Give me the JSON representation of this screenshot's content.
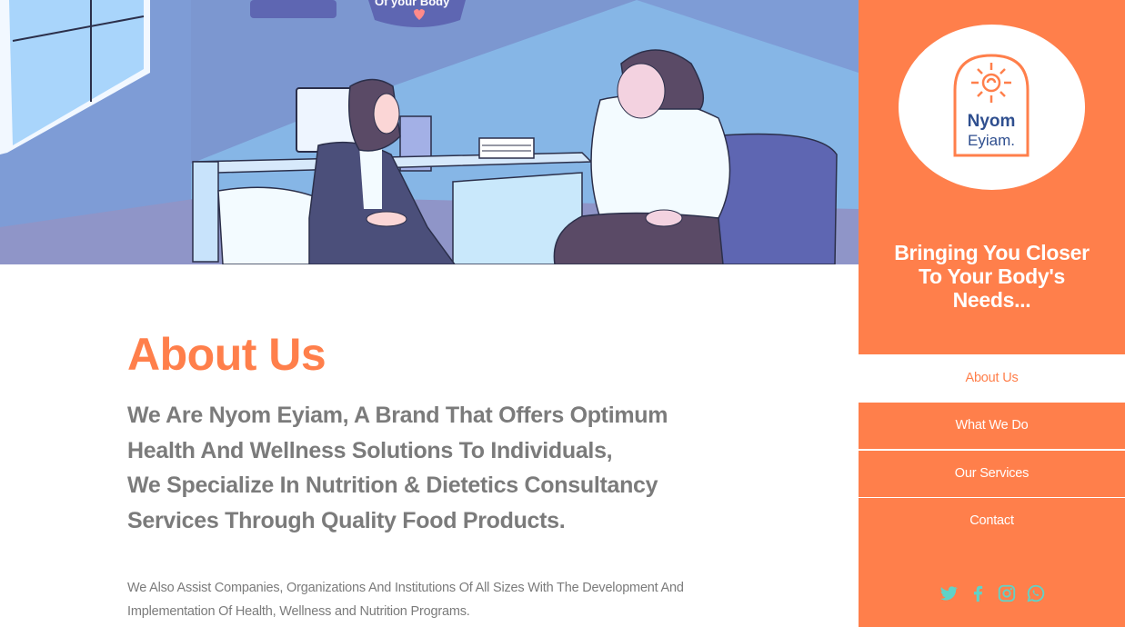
{
  "hero": {
    "poster_text": "Of your Body"
  },
  "about": {
    "title": "About Us",
    "lead_lines": [
      "We Are Nyom Eyiam, A Brand That Offers Optimum",
      "Health And Wellness Solutions To Individuals,",
      "We Specialize In Nutrition & Dietetics Consultancy",
      "Services Through Quality Food Products."
    ],
    "body_lines": [
      "We Also Assist Companies, Organizations And Institutions Of All Sizes With The Development And",
      "Implementation Of Health, Wellness and Nutrition Programs."
    ]
  },
  "sidebar": {
    "logo": {
      "line1": "Nyom",
      "line2": "Eyiam."
    },
    "tagline_lines": [
      "Bringing You Closer",
      "To Your Body's",
      "Needs..."
    ],
    "nav": [
      {
        "label": "About Us",
        "active": true
      },
      {
        "label": "What We Do",
        "active": false
      },
      {
        "label": "Our Services",
        "active": false
      },
      {
        "label": "Contact",
        "active": false
      }
    ],
    "socials": [
      "twitter-icon",
      "facebook-icon",
      "instagram-icon",
      "whatsapp-icon"
    ]
  },
  "colors": {
    "brand_orange": "#ff7f4b",
    "text_gray": "#7b7b7b",
    "social_teal": "#5fd3c8",
    "logo_blue": "#2f4f8f"
  }
}
